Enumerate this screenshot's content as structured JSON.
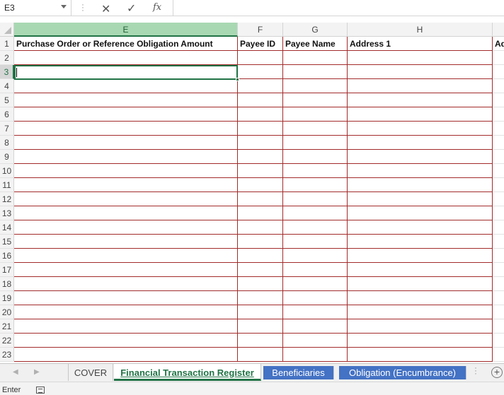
{
  "formula_bar": {
    "name_box": "E3",
    "cancel_icon": "close-icon",
    "enter_icon": "check-icon",
    "fx_label": "fx",
    "formula_value": ""
  },
  "columns": [
    {
      "letter": "E",
      "active": true
    },
    {
      "letter": "F",
      "active": false
    },
    {
      "letter": "G",
      "active": false
    },
    {
      "letter": "H",
      "active": false
    },
    {
      "letter": "",
      "active": false
    }
  ],
  "header_row": {
    "row_number": "1",
    "cells": [
      "Purchase Order or Reference Obligation Amount",
      "Payee ID",
      "Payee Name",
      "Address 1",
      "Ad"
    ]
  },
  "rows": [
    "2",
    "3",
    "4",
    "5",
    "6",
    "7",
    "8",
    "9",
    "10",
    "11",
    "12",
    "13",
    "14",
    "15",
    "16",
    "17",
    "18",
    "19",
    "20",
    "21",
    "22",
    "23"
  ],
  "active_row": "3",
  "sheet_tabs": [
    {
      "label": "COVER",
      "state": "inactive"
    },
    {
      "label": "Financial Transaction Register",
      "state": "active"
    },
    {
      "label": "Beneficiaries",
      "state": "colored"
    },
    {
      "label": "Obligation (Encumbrance)",
      "state": "colored"
    }
  ],
  "tab_color": "#4472c4",
  "accent_color": "#217346",
  "status_bar": {
    "mode": "Enter",
    "macro_icon": "macro-record-icon"
  }
}
